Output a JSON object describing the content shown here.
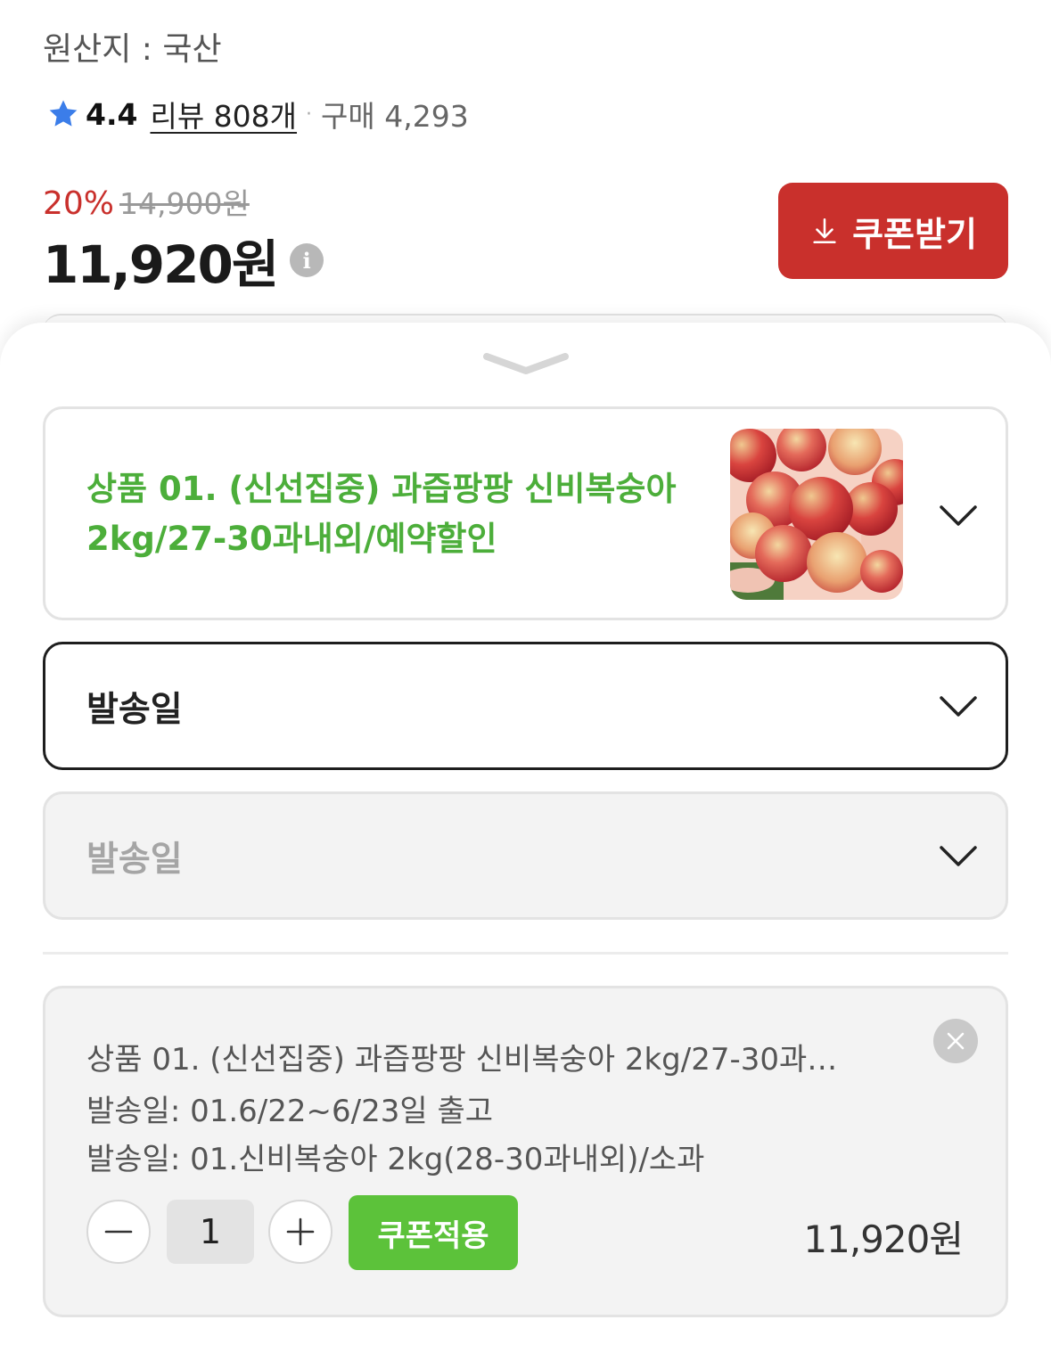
{
  "product_info": {
    "origin": "원산지 : 국산",
    "rating": "4.4",
    "review_link": "리뷰 808개",
    "separator": "·",
    "purchase_count": "구매 4,293",
    "discount_percent": "20%",
    "original_price": "14,900원",
    "sale_price": "11,920원",
    "info_icon_glyph": "i",
    "coupon_button_label": "쿠폰받기",
    "accent_color": "#c9302c"
  },
  "option_sheet": {
    "product_option": {
      "title": "상품 01. (신선집중) 과즙팡팡 신비복숭아 2kg/27-30과내외/예약할인",
      "title_color": "#4cae3a"
    },
    "shipping_select_1": {
      "label": "발송일"
    },
    "shipping_select_2": {
      "label": "발송일"
    },
    "selected_item": {
      "product_line": "상품 01. (신선집중) 과즙팡팡 신비복숭아 2kg/27-30과…",
      "shipping_line_1": "발송일: 01.6/22~6/23일 출고",
      "shipping_line_2": "발송일: 01.신비복숭아 2kg(28-30과내외)/소과",
      "quantity": "1",
      "coupon_apply_label": "쿠폰적용",
      "price": "11,920원",
      "coupon_apply_color": "#5cc23a"
    }
  }
}
